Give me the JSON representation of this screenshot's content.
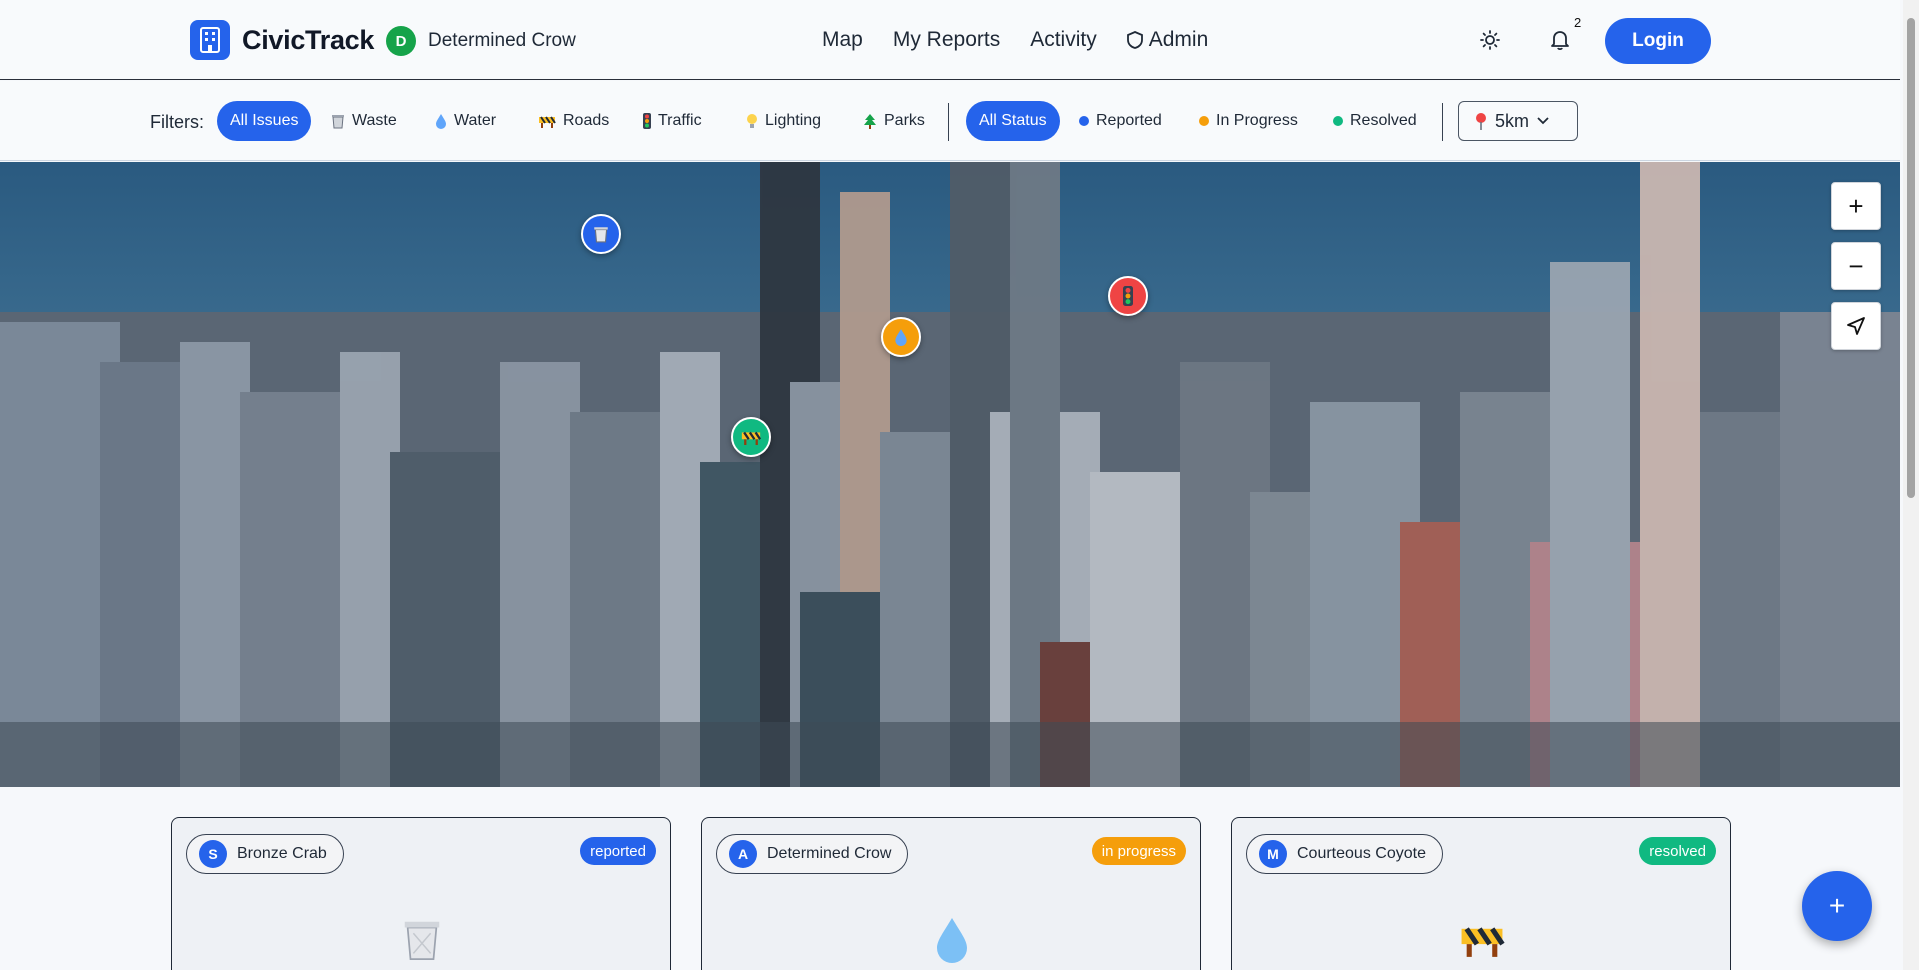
{
  "header": {
    "brand": "CivicTrack",
    "user": {
      "initial": "D",
      "name": "Determined Crow"
    },
    "nav": [
      {
        "label": "Map"
      },
      {
        "label": "My Reports"
      },
      {
        "label": "Activity"
      },
      {
        "label": "Admin",
        "icon": "shield-icon"
      }
    ],
    "notifications_count": "2",
    "login_label": "Login"
  },
  "filters": {
    "label": "Filters:",
    "categories": [
      {
        "label": "All Issues",
        "active": true
      },
      {
        "label": "Waste",
        "icon": "trash-icon"
      },
      {
        "label": "Water",
        "icon": "droplet-icon"
      },
      {
        "label": "Roads",
        "icon": "barrier-icon"
      },
      {
        "label": "Traffic",
        "icon": "traffic-light-icon"
      },
      {
        "label": "Lighting",
        "icon": "bulb-icon"
      },
      {
        "label": "Parks",
        "icon": "tree-icon"
      }
    ],
    "statuses": [
      {
        "label": "All Status",
        "active": true
      },
      {
        "label": "Reported",
        "color": "#2563eb"
      },
      {
        "label": "In Progress",
        "color": "#f59e0b"
      },
      {
        "label": "Resolved",
        "color": "#10b981"
      }
    ],
    "radius": "5km"
  },
  "map": {
    "markers": [
      {
        "category": "waste",
        "color": "#2563eb",
        "icon": "trash-icon"
      },
      {
        "category": "water",
        "color": "#f59e0b",
        "icon": "droplet-icon"
      },
      {
        "category": "traffic",
        "color": "#ef4444",
        "icon": "traffic-light-icon"
      },
      {
        "category": "roads",
        "color": "#10b981",
        "icon": "barrier-icon"
      }
    ],
    "controls": {
      "zoom_in": "+",
      "zoom_out": "−"
    }
  },
  "cards": [
    {
      "initial": "S",
      "name": "Bronze Crab",
      "status": "reported",
      "status_color": "#2563eb",
      "icon": "trash-icon"
    },
    {
      "initial": "A",
      "name": "Determined Crow",
      "status": "in progress",
      "status_color": "#f59e0b",
      "icon": "droplet-icon"
    },
    {
      "initial": "M",
      "name": "Courteous Coyote",
      "status": "resolved",
      "status_color": "#10b981",
      "icon": "barrier-icon"
    }
  ],
  "fab_label": "+",
  "colors": {
    "accent": "#2563eb",
    "reported": "#2563eb",
    "in_progress": "#f59e0b",
    "resolved": "#10b981",
    "traffic": "#ef4444"
  }
}
